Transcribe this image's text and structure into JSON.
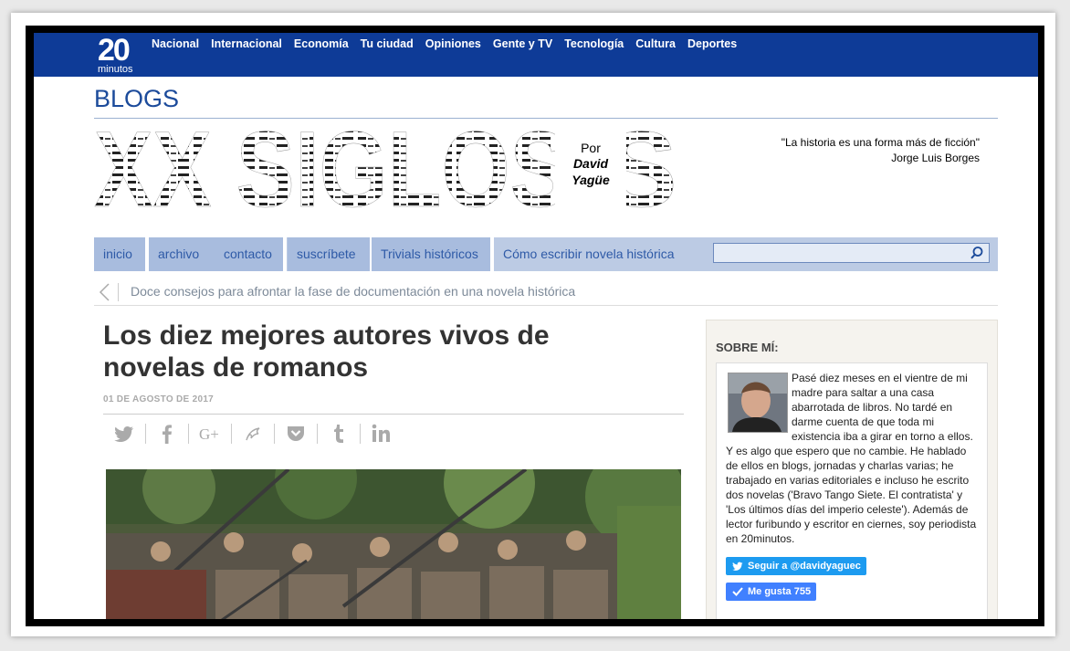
{
  "topbar": {
    "logo_number": "20",
    "logo_sub": "minutos",
    "nav": [
      "Nacional",
      "Internacional",
      "Economía",
      "Tu ciudad",
      "Opiniones",
      "Gente y TV",
      "Tecnología",
      "Cultura",
      "Deportes"
    ]
  },
  "blog": {
    "section_label": "BLOGS",
    "masthead_title": "XX SIGLOS",
    "by_label": "Por",
    "author_first": "David",
    "author_last": "Yagüe",
    "quote": "\"La historia es una forma más de ficción\"",
    "quote_author": "Jorge Luis Borges"
  },
  "menu": {
    "items": [
      "inicio",
      "archivo",
      "contacto",
      "suscríbete",
      "Trivials históricos",
      "Cómo escribir novela histórica"
    ],
    "search_placeholder": ""
  },
  "previous_post": "Doce consejos para afrontar la fase de documentación en una novela histórica",
  "article": {
    "title": "Los diez mejores autores vivos de novelas de romanos",
    "date": "01 DE AGOSTO DE 2017",
    "share_icons": [
      "twitter-icon",
      "facebook-icon",
      "google-plus-icon",
      "meneame-icon",
      "pocket-icon",
      "tumblr-icon",
      "linkedin-icon"
    ]
  },
  "sidebar": {
    "heading": "SOBRE MÍ:",
    "bio": "Pasé diez meses en el vientre de mi madre para saltar a una casa abarrotada de libros. No tardé en darme cuenta de que toda mi existencia iba a girar en torno a ellos. Y es algo que espero que no cambie. He hablado de ellos en blogs, jornadas y charlas varias; he trabajado en varias editoriales e incluso he escrito dos novelas ('Bravo Tango Siete. El contratista' y 'Los últimos días del imperio celeste'). Además de lector furibundo y escritor en ciernes, soy periodista en 20minutos.",
    "twitter_button": "Seguir a @davidyaguec",
    "like_button": "Me gusta 755"
  },
  "colors": {
    "brand_blue": "#0e3b97",
    "menu_bg": "#a8bcde",
    "link_blue": "#2e5aa7"
  }
}
